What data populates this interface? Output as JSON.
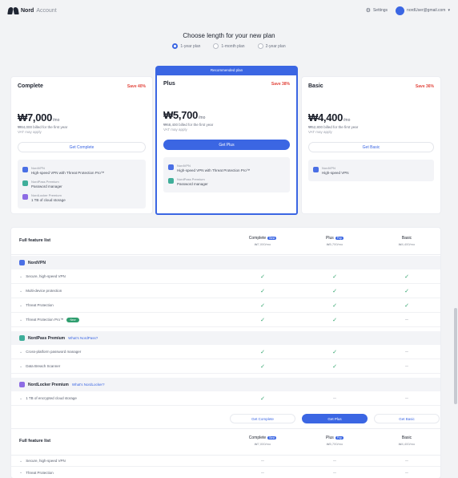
{
  "header": {
    "brand": "Nord",
    "brand_sub": "Account",
    "settings_label": "Settings",
    "account_label": "nordUser@gmail.com"
  },
  "chooser": {
    "title": "Choose length for your new plan",
    "periods": [
      {
        "label": "1-year plan",
        "selected": true
      },
      {
        "label": "1-month plan",
        "selected": false
      },
      {
        "label": "2-year plan",
        "selected": false
      }
    ]
  },
  "plans": [
    {
      "name": "Complete",
      "discount": "Save 40%",
      "price": "₩7,000",
      "per": "/mo",
      "billed": "₩84,000 billed for the first year",
      "renew": "VAT may apply",
      "button": "Get Complete",
      "features": [
        {
          "title": "NordVPN",
          "desc": "High-speed VPN with Threat Protection Pro™"
        },
        {
          "title": "NordPass Premium",
          "desc": "Password manager"
        },
        {
          "title": "NordLocker Premium",
          "desc": "1 TB of cloud storage"
        }
      ]
    },
    {
      "name": "Plus",
      "banner": "Recommended plan",
      "discount": "Save 38%",
      "price": "₩5,700",
      "per": "/mo",
      "billed": "₩68,400 billed for the first year",
      "renew": "VAT may apply",
      "button": "Get Plus",
      "features": [
        {
          "title": "NordVPN",
          "desc": "High-speed VPN with Threat Protection Pro™"
        },
        {
          "title": "NordPass Premium",
          "desc": "Password manager"
        }
      ]
    },
    {
      "name": "Basic",
      "discount": "Save 36%",
      "price": "₩4,400",
      "per": "/mo",
      "billed": "₩52,800 billed for the first year",
      "renew": "VAT may apply",
      "button": "Get Basic",
      "features": [
        {
          "title": "NordVPN",
          "desc": "High-speed VPN"
        }
      ]
    }
  ],
  "compare": {
    "label": "Full feature list",
    "columns": [
      {
        "name": "Complete",
        "tag": "Best",
        "price": "₩7,000/mo"
      },
      {
        "name": "Plus",
        "tag": "Pop",
        "price": "₩5,700/mo"
      },
      {
        "name": "Basic",
        "tag": "",
        "price": "₩4,400/mo"
      }
    ],
    "sections": [
      {
        "name": "NordVPN",
        "link": "",
        "rows": [
          {
            "label": "Secure, high-speed VPN",
            "marks": [
              "yes",
              "yes",
              "yes"
            ]
          },
          {
            "label": "Multi-device protection",
            "marks": [
              "yes",
              "yes",
              "yes"
            ]
          },
          {
            "label": "Threat Protection",
            "marks": [
              "yes",
              "yes",
              "yes"
            ]
          },
          {
            "label": "Threat Protection Pro™",
            "badge": "New",
            "marks": [
              "yes",
              "yes",
              "no"
            ]
          }
        ]
      },
      {
        "name": "NordPass Premium",
        "link": "What's NordPass?",
        "rows": [
          {
            "label": "Cross-platform password manager",
            "marks": [
              "yes",
              "yes",
              "no"
            ]
          },
          {
            "label": "Data Breach Scanner",
            "marks": [
              "yes",
              "yes",
              "no"
            ]
          }
        ]
      },
      {
        "name": "NordLocker Premium",
        "link": "What's NordLocker?",
        "rows": [
          {
            "label": "1 TB of encrypted cloud storage",
            "marks": [
              "yes",
              "no",
              "no"
            ]
          }
        ]
      }
    ],
    "buttons": [
      "Get Complete",
      "Get Plus",
      "Get Basic"
    ],
    "footer_label": "Full feature list",
    "footer_rows": [
      {
        "label": "Secure, high-speed VPN",
        "marks": [
          "no",
          "no",
          "no"
        ]
      },
      {
        "label": "Threat Protection",
        "marks": [
          "no",
          "no",
          "no"
        ]
      }
    ]
  }
}
